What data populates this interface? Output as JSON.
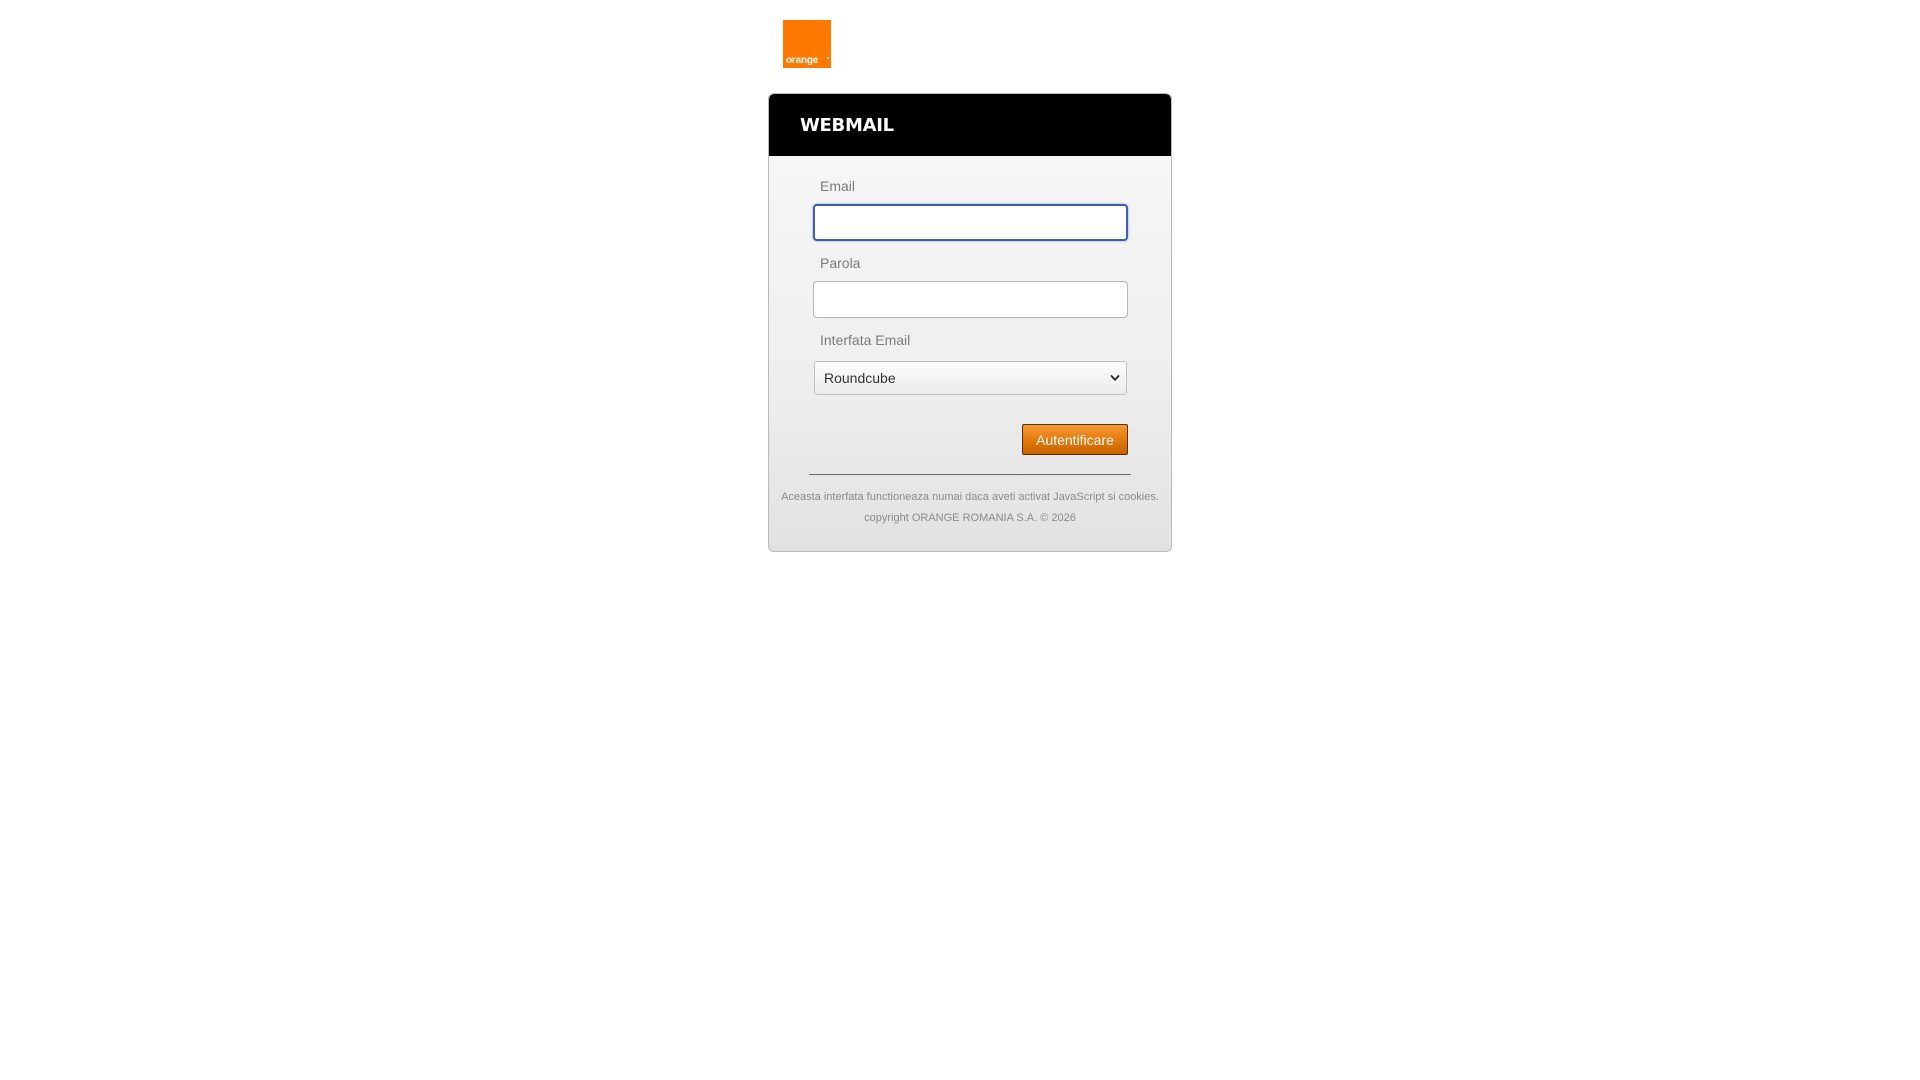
{
  "brand": {
    "logo_text": "orange",
    "logo_color": "#ff7900"
  },
  "header": {
    "title": "WEBMAIL"
  },
  "form": {
    "email_label": "Email",
    "email_value": "",
    "password_label": "Parola",
    "password_value": "",
    "interface_label": "Interfata Email",
    "interface_selected": "Roundcube",
    "submit_label": "Autentificare"
  },
  "footer": {
    "notice": "Aceasta interfata functioneaza numai daca aveti activat JavaScript si cookies.",
    "copyright": "copyright ORANGE ROMANIA S.A. © 2026"
  },
  "colors": {
    "accent": "#ff7900",
    "button": "#e57a0c",
    "header_bg": "#000000",
    "focus_border": "#3f5fae"
  },
  "icons": {
    "select_arrow": "chevron-down-icon"
  }
}
